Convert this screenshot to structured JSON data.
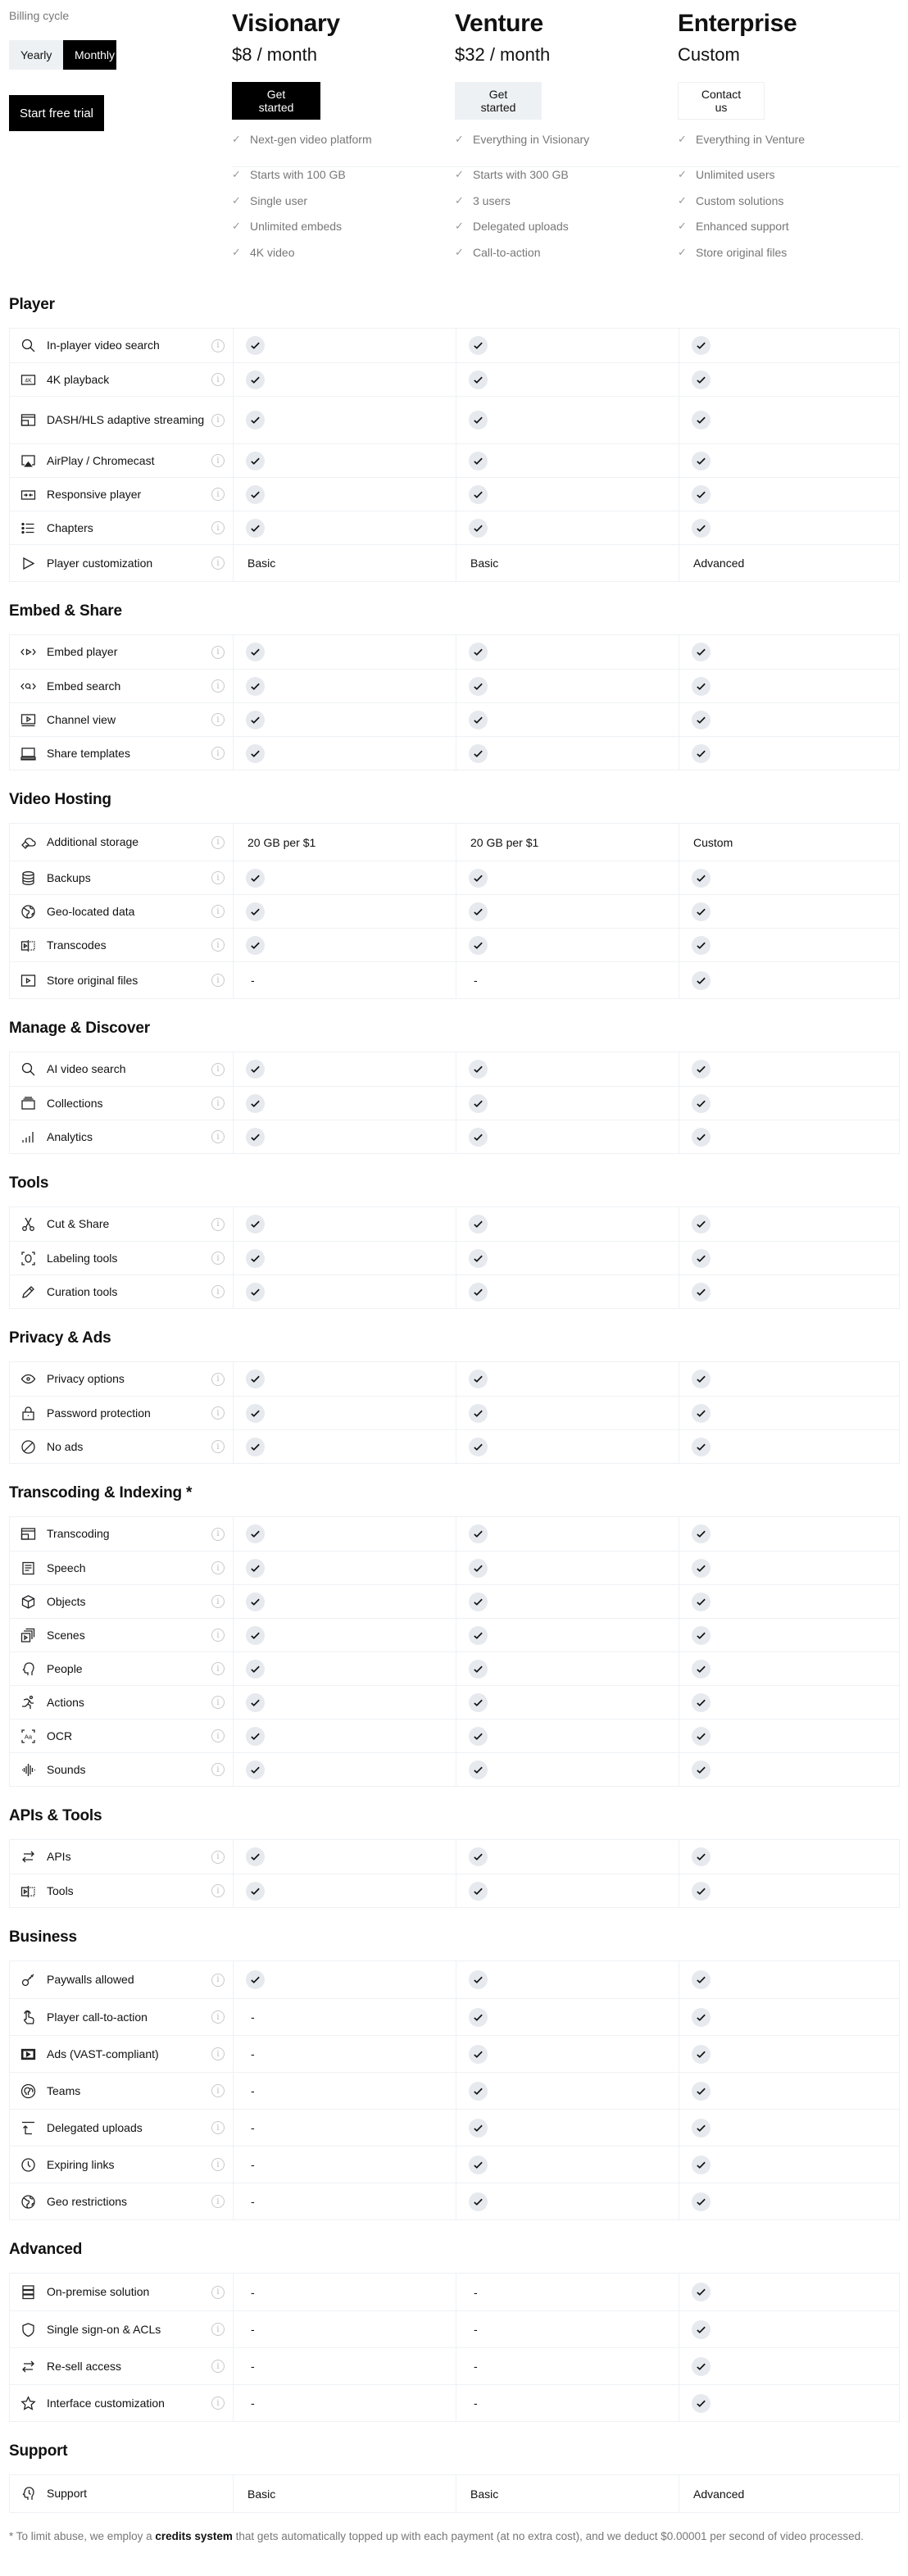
{
  "billing": {
    "label": "Billing cycle",
    "options": [
      "Yearly",
      "Monthly"
    ],
    "selected": "Monthly",
    "trial_button": "Start free trial"
  },
  "plans": [
    {
      "name": "Visionary",
      "price": "$8 / month",
      "button": "Get started",
      "button_style": "primary",
      "headline_feature": "Next-gen video platform",
      "features": [
        "Starts with 100 GB",
        "Single user",
        "Unlimited embeds",
        "4K video"
      ]
    },
    {
      "name": "Venture",
      "price": "$32 / month",
      "button": "Get started",
      "button_style": "secondary",
      "headline_feature": "Everything in Visionary",
      "features": [
        "Starts with 300 GB",
        "3 users",
        "Delegated uploads",
        "Call-to-action"
      ]
    },
    {
      "name": "Enterprise",
      "price": "Custom",
      "button": "Contact us",
      "button_style": "outline",
      "headline_feature": "Everything in Venture",
      "features": [
        "Unlimited users",
        "Custom solutions",
        "Enhanced support",
        "Store original files"
      ]
    }
  ],
  "sections": [
    {
      "title": "Player",
      "rows": [
        {
          "icon": "search-icon",
          "label": "In-player video search",
          "values": [
            "check",
            "check",
            "check"
          ]
        },
        {
          "icon": "4k-icon",
          "label": "4K playback",
          "values": [
            "check",
            "check",
            "check"
          ]
        },
        {
          "icon": "adaptive-streaming-icon",
          "label": "DASH/HLS adaptive streaming",
          "values": [
            "check",
            "check",
            "check"
          ]
        },
        {
          "icon": "airplay-icon",
          "label": "AirPlay / Chromecast",
          "values": [
            "check",
            "check",
            "check"
          ]
        },
        {
          "icon": "responsive-icon",
          "label": "Responsive player",
          "values": [
            "check",
            "check",
            "check"
          ]
        },
        {
          "icon": "list-icon",
          "label": "Chapters",
          "values": [
            "check",
            "check",
            "check"
          ]
        },
        {
          "icon": "play-icon",
          "label": "Player customization",
          "values": [
            "Basic",
            "Basic",
            "Advanced"
          ]
        }
      ]
    },
    {
      "title": "Embed & Share",
      "rows": [
        {
          "icon": "embed-play-icon",
          "label": "Embed player",
          "values": [
            "check",
            "check",
            "check"
          ]
        },
        {
          "icon": "embed-search-icon",
          "label": "Embed search",
          "values": [
            "check",
            "check",
            "check"
          ]
        },
        {
          "icon": "channel-icon",
          "label": "Channel view",
          "values": [
            "check",
            "check",
            "check"
          ]
        },
        {
          "icon": "laptop-icon",
          "label": "Share templates",
          "values": [
            "check",
            "check",
            "check"
          ]
        }
      ]
    },
    {
      "title": "Video Hosting",
      "rows": [
        {
          "icon": "cloud-tag-icon",
          "label": "Additional storage",
          "values": [
            "20 GB per $1",
            "20 GB per $1",
            "Custom"
          ]
        },
        {
          "icon": "database-icon",
          "label": "Backups",
          "values": [
            "check",
            "check",
            "check"
          ]
        },
        {
          "icon": "globe-icon",
          "label": "Geo-located data",
          "values": [
            "check",
            "check",
            "check"
          ]
        },
        {
          "icon": "transcode-icon",
          "label": "Transcodes",
          "values": [
            "check",
            "check",
            "check"
          ]
        },
        {
          "icon": "video-file-icon",
          "label": "Store original files",
          "values": [
            "-",
            "-",
            "check"
          ]
        }
      ]
    },
    {
      "title": "Manage & Discover",
      "rows": [
        {
          "icon": "search-icon",
          "label": "AI video search",
          "values": [
            "check",
            "check",
            "check"
          ]
        },
        {
          "icon": "collections-icon",
          "label": "Collections",
          "values": [
            "check",
            "check",
            "check"
          ]
        },
        {
          "icon": "analytics-icon",
          "label": "Analytics",
          "values": [
            "check",
            "check",
            "check"
          ]
        }
      ]
    },
    {
      "title": "Tools",
      "rows": [
        {
          "icon": "scissors-icon",
          "label": "Cut & Share",
          "values": [
            "check",
            "check",
            "check"
          ]
        },
        {
          "icon": "face-scan-icon",
          "label": "Labeling tools",
          "values": [
            "check",
            "check",
            "check"
          ]
        },
        {
          "icon": "pencil-icon",
          "label": "Curation tools",
          "values": [
            "check",
            "check",
            "check"
          ]
        }
      ]
    },
    {
      "title": "Privacy & Ads",
      "rows": [
        {
          "icon": "eye-icon",
          "label": "Privacy options",
          "values": [
            "check",
            "check",
            "check"
          ]
        },
        {
          "icon": "lock-icon",
          "label": "Password protection",
          "values": [
            "check",
            "check",
            "check"
          ]
        },
        {
          "icon": "no-icon",
          "label": "No ads",
          "values": [
            "check",
            "check",
            "check"
          ]
        }
      ]
    },
    {
      "title": "Transcoding & Indexing *",
      "rows": [
        {
          "icon": "adaptive-streaming-icon",
          "label": "Transcoding",
          "values": [
            "check",
            "check",
            "check"
          ]
        },
        {
          "icon": "document-icon",
          "label": "Speech",
          "values": [
            "check",
            "check",
            "check"
          ]
        },
        {
          "icon": "cube-icon",
          "label": "Objects",
          "values": [
            "check",
            "check",
            "check"
          ]
        },
        {
          "icon": "scenes-icon",
          "label": "Scenes",
          "values": [
            "check",
            "check",
            "check"
          ]
        },
        {
          "icon": "head-icon",
          "label": "People",
          "values": [
            "check",
            "check",
            "check"
          ]
        },
        {
          "icon": "running-icon",
          "label": "Actions",
          "values": [
            "check",
            "check",
            "check"
          ]
        },
        {
          "icon": "text-scan-icon",
          "label": "OCR",
          "values": [
            "check",
            "check",
            "check"
          ]
        },
        {
          "icon": "waveform-icon",
          "label": "Sounds",
          "values": [
            "check",
            "check",
            "check"
          ]
        }
      ]
    },
    {
      "title": "APIs & Tools",
      "rows": [
        {
          "icon": "arrows-swap-icon",
          "label": "APIs",
          "values": [
            "check",
            "check",
            "check"
          ]
        },
        {
          "icon": "transcode-icon",
          "label": "Tools",
          "values": [
            "check",
            "check",
            "check"
          ]
        }
      ]
    },
    {
      "title": "Business",
      "rows": [
        {
          "icon": "key-icon",
          "label": "Paywalls allowed",
          "values": [
            "check",
            "check",
            "check"
          ]
        },
        {
          "icon": "hand-pointer-icon",
          "label": "Player call-to-action",
          "values": [
            "-",
            "check",
            "check"
          ]
        },
        {
          "icon": "ad-play-icon",
          "label": "Ads (VAST-compliant)",
          "values": [
            "-",
            "check",
            "check"
          ]
        },
        {
          "icon": "teams-icon",
          "label": "Teams",
          "values": [
            "-",
            "check",
            "check"
          ]
        },
        {
          "icon": "upload-icon",
          "label": "Delegated uploads",
          "values": [
            "-",
            "check",
            "check"
          ]
        },
        {
          "icon": "clock-icon",
          "label": "Expiring links",
          "values": [
            "-",
            "check",
            "check"
          ]
        },
        {
          "icon": "globe-icon",
          "label": "Geo restrictions",
          "values": [
            "-",
            "check",
            "check"
          ]
        }
      ]
    },
    {
      "title": "Advanced",
      "rows": [
        {
          "icon": "server-icon",
          "label": "On-premise solution",
          "values": [
            "-",
            "-",
            "check"
          ]
        },
        {
          "icon": "shield-icon",
          "label": "Single sign-on & ACLs",
          "values": [
            "-",
            "-",
            "check"
          ]
        },
        {
          "icon": "arrows-swap-icon",
          "label": "Re-sell access",
          "values": [
            "-",
            "-",
            "check"
          ]
        },
        {
          "icon": "star-icon",
          "label": "Interface customization",
          "values": [
            "-",
            "-",
            "check"
          ]
        }
      ]
    },
    {
      "title": "Support",
      "rows": [
        {
          "icon": "support-head-icon",
          "label": "Support",
          "values": [
            "Basic",
            "Basic",
            "Advanced"
          ],
          "no_info": true
        }
      ]
    }
  ],
  "footnote": {
    "prefix": "* To limit abuse, we employ a ",
    "bold": "credits system",
    "suffix": " that gets automatically topped up with each payment (at no extra cost), and we deduct $0.00001 per second of video processed."
  }
}
